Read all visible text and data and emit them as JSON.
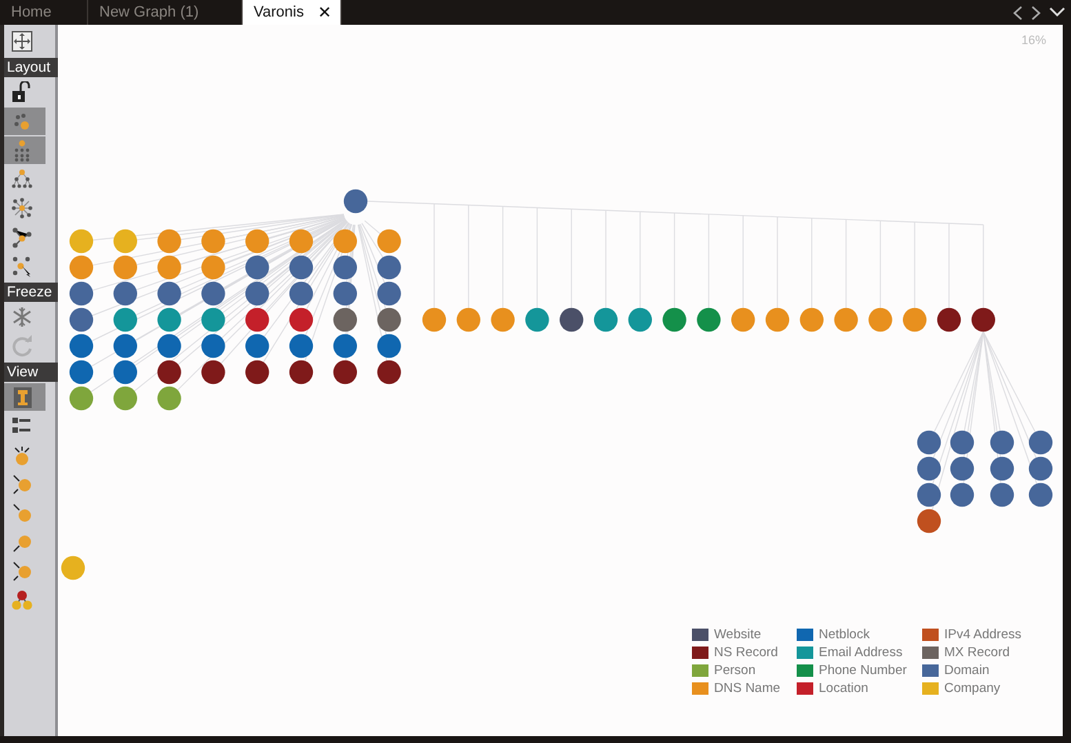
{
  "tabs": [
    {
      "label": "Home",
      "selected": false
    },
    {
      "label": "New Graph (1)",
      "selected": false
    },
    {
      "label": "Varonis",
      "selected": true,
      "close": "✕"
    }
  ],
  "sidebar": {
    "items": [
      {
        "kind": "button",
        "selected": false,
        "disabled": false
      },
      {
        "kind": "label",
        "text": "Layout"
      },
      {
        "kind": "button",
        "selected": false,
        "disabled": false
      },
      {
        "kind": "button",
        "selected": true,
        "disabled": false
      },
      {
        "kind": "button",
        "selected": true,
        "disabled": false
      },
      {
        "kind": "button",
        "selected": false,
        "disabled": false
      },
      {
        "kind": "button",
        "selected": false,
        "disabled": false
      },
      {
        "kind": "button",
        "selected": false,
        "disabled": false
      },
      {
        "kind": "button",
        "selected": false,
        "disabled": false
      },
      {
        "kind": "label",
        "text": "Freeze"
      },
      {
        "kind": "button",
        "selected": false,
        "disabled": false
      },
      {
        "kind": "button",
        "selected": false,
        "disabled": true
      },
      {
        "kind": "label",
        "text": "View"
      },
      {
        "kind": "button",
        "selected": true,
        "disabled": false
      },
      {
        "kind": "button",
        "selected": false,
        "disabled": false
      },
      {
        "kind": "button",
        "selected": false,
        "disabled": false
      },
      {
        "kind": "button",
        "selected": false,
        "disabled": false
      },
      {
        "kind": "button",
        "selected": false,
        "disabled": false
      },
      {
        "kind": "button",
        "selected": false,
        "disabled": false
      },
      {
        "kind": "button",
        "selected": false,
        "disabled": false
      },
      {
        "kind": "button",
        "selected": false,
        "disabled": false
      }
    ]
  },
  "canvas": {
    "zoom": "16%",
    "graph": {
      "root": {
        "color": "#47679a"
      },
      "cluster_rows": [
        [
          {
            "color": "#e6b11f"
          },
          {
            "color": "#e6b11f"
          },
          {
            "color": "#e8901e"
          },
          {
            "color": "#e8901e"
          },
          {
            "color": "#e8901e"
          },
          {
            "color": "#e8901e"
          },
          {
            "color": "#e8901e"
          },
          {
            "color": "#e8901e"
          }
        ],
        [
          {
            "color": "#e8901e"
          },
          {
            "color": "#e8901e"
          },
          {
            "color": "#e8901e"
          },
          {
            "color": "#e8901e"
          },
          {
            "color": "#47679a"
          },
          {
            "color": "#47679a"
          },
          {
            "color": "#47679a"
          },
          {
            "color": "#47679a"
          }
        ],
        [
          {
            "color": "#47679a"
          },
          {
            "color": "#47679a"
          },
          {
            "color": "#47679a"
          },
          {
            "color": "#47679a"
          },
          {
            "color": "#47679a"
          },
          {
            "color": "#47679a"
          },
          {
            "color": "#47679a"
          },
          {
            "color": "#47679a"
          }
        ],
        [
          {
            "color": "#47679a"
          },
          {
            "color": "#14969a"
          },
          {
            "color": "#14969a"
          },
          {
            "color": "#14969a"
          },
          {
            "color": "#c4202a"
          },
          {
            "color": "#c4202a"
          },
          {
            "color": "#6c6460"
          },
          {
            "color": "#6c6460"
          }
        ],
        [
          {
            "color": "#1067b0"
          },
          {
            "color": "#1067b0"
          },
          {
            "color": "#1067b0"
          },
          {
            "color": "#1067b0"
          },
          {
            "color": "#1067b0"
          },
          {
            "color": "#1067b0"
          },
          {
            "color": "#1067b0"
          },
          {
            "color": "#1067b0"
          }
        ],
        [
          {
            "color": "#1067b0"
          },
          {
            "color": "#1067b0"
          },
          {
            "color": "#7f1a1a"
          },
          {
            "color": "#7f1a1a"
          },
          {
            "color": "#7f1a1a"
          },
          {
            "color": "#7f1a1a"
          },
          {
            "color": "#7f1a1a"
          },
          {
            "color": "#7f1a1a"
          }
        ],
        [
          {
            "color": "#7fa63c"
          },
          {
            "color": "#7fa63c"
          },
          {
            "color": "#7fa63c"
          }
        ]
      ],
      "chain": [
        {
          "color": "#e8901e"
        },
        {
          "color": "#e8901e"
        },
        {
          "color": "#e8901e"
        },
        {
          "color": "#14969a"
        },
        {
          "color": "#4b5068"
        },
        {
          "color": "#14969a"
        },
        {
          "color": "#14969a"
        },
        {
          "color": "#14904a"
        },
        {
          "color": "#14904a"
        },
        {
          "color": "#e8901e"
        },
        {
          "color": "#e8901e"
        },
        {
          "color": "#e8901e"
        },
        {
          "color": "#e8901e"
        },
        {
          "color": "#e8901e"
        },
        {
          "color": "#e8901e"
        },
        {
          "color": "#7f1a1a"
        },
        {
          "color": "#7f1a1a",
          "children": [
            {
              "color": "#47679a"
            },
            {
              "color": "#47679a"
            },
            {
              "color": "#47679a"
            },
            {
              "color": "#47679a"
            },
            {
              "color": "#47679a"
            },
            {
              "color": "#47679a"
            },
            {
              "color": "#47679a"
            },
            {
              "color": "#47679a"
            },
            {
              "color": "#47679a"
            },
            {
              "color": "#47679a"
            },
            {
              "color": "#47679a"
            },
            {
              "color": "#47679a"
            },
            {
              "color": "#c0501f"
            }
          ]
        }
      ],
      "loose": [
        {
          "color": "#e6b11f"
        }
      ]
    },
    "legend": [
      {
        "label": "Website",
        "color": "#4b5068"
      },
      {
        "label": "Netblock",
        "color": "#1067b0"
      },
      {
        "label": "IPv4 Address",
        "color": "#c0501f"
      },
      {
        "label": "NS Record",
        "color": "#7f1a1a"
      },
      {
        "label": "Email Address",
        "color": "#14969a"
      },
      {
        "label": "MX Record",
        "color": "#6c6460"
      },
      {
        "label": "Person",
        "color": "#7fa63c"
      },
      {
        "label": "Phone Number",
        "color": "#14904a"
      },
      {
        "label": "Domain",
        "color": "#47679a"
      },
      {
        "label": "DNS Name",
        "color": "#e8901e"
      },
      {
        "label": "Location",
        "color": "#c4202a"
      },
      {
        "label": "Company",
        "color": "#e6b11f"
      }
    ]
  }
}
